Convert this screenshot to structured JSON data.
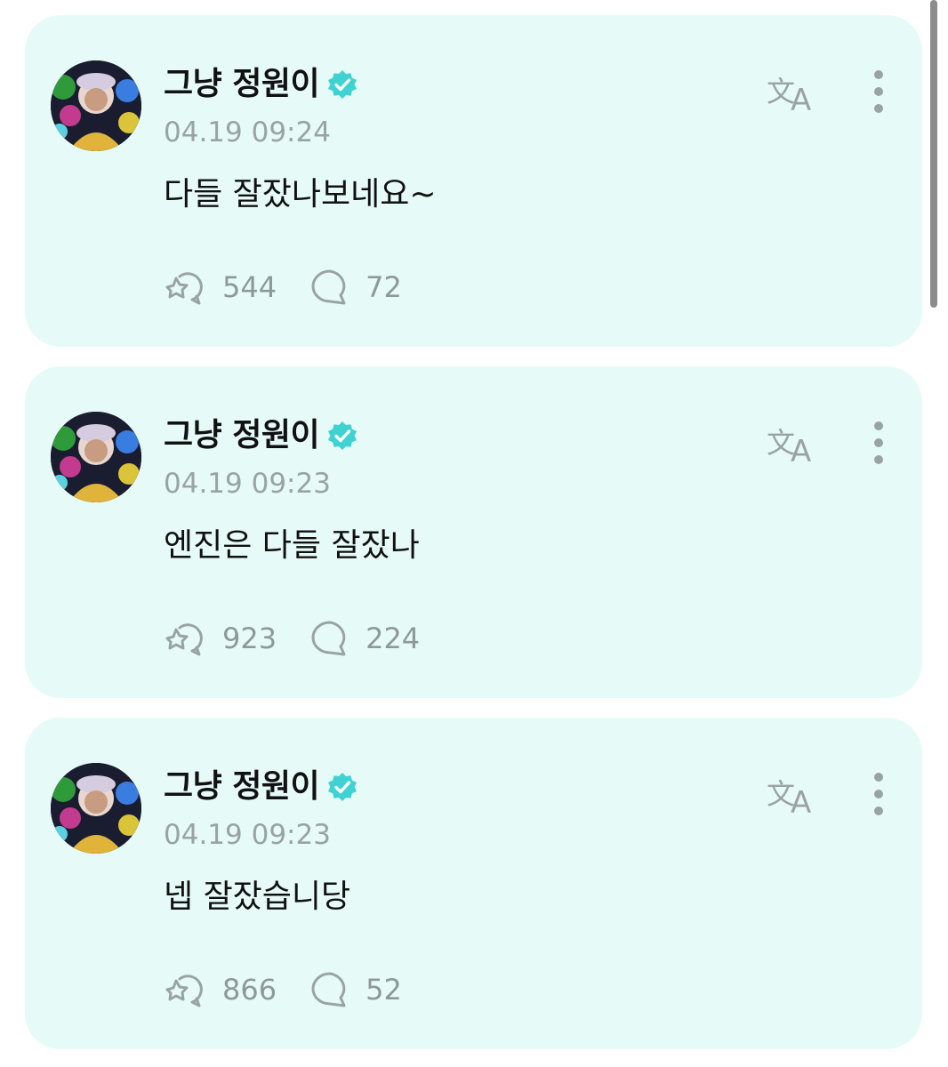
{
  "posts": [
    {
      "author": "그냥 정원이",
      "time": "04.19 09:24",
      "text": "다들 잘잤나보네요~",
      "reactions": "544",
      "comments": "72"
    },
    {
      "author": "그냥 정원이",
      "time": "04.19 09:23",
      "text": "엔진은 다들 잘잤나",
      "reactions": "923",
      "comments": "224"
    },
    {
      "author": "그냥 정원이",
      "time": "04.19 09:23",
      "text": "넵 잘잤습니당",
      "reactions": "866",
      "comments": "52"
    }
  ],
  "colors": {
    "card_background": "#e6fbf8",
    "verified_badge": "#3fd2d2",
    "muted_text": "#9aa3a4"
  },
  "icons": {
    "verified": "verified-badge-icon",
    "translate": "translate-icon",
    "more": "more-vertical-icon",
    "reaction": "reaction-star-bubble-icon",
    "comment": "comment-bubble-icon"
  }
}
